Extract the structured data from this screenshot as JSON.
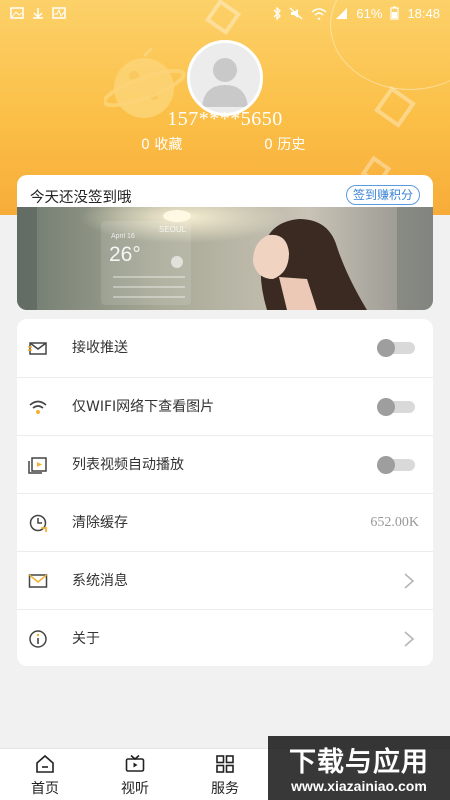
{
  "status_bar": {
    "battery": "61%",
    "time": "18:48"
  },
  "profile": {
    "phone": "157****5650",
    "favorites": "0 收藏",
    "history": "0 历史"
  },
  "signin": {
    "title": "今天还没签到哦",
    "button_label": "签到赚积分"
  },
  "banner": {
    "city": "SEOUL",
    "date": "April 16",
    "temperature": "26°"
  },
  "settings": {
    "items": [
      {
        "label": "接收推送",
        "icon": "envelope-push-icon",
        "type": "toggle",
        "on": false
      },
      {
        "label": "仅WIFI网络下查看图片",
        "icon": "wifi-icon",
        "type": "toggle",
        "on": false
      },
      {
        "label": "列表视频自动播放",
        "icon": "video-play-icon",
        "type": "toggle",
        "on": false
      },
      {
        "label": "清除缓存",
        "icon": "clock-clear-icon",
        "type": "value",
        "value": "652.00K"
      },
      {
        "label": "系统消息",
        "icon": "mail-icon",
        "type": "chevron"
      },
      {
        "label": "关于",
        "icon": "info-icon",
        "type": "chevron"
      }
    ]
  },
  "bottom_nav": {
    "items": [
      {
        "label": "首页",
        "icon": "home-icon"
      },
      {
        "label": "视听",
        "icon": "tv-icon"
      },
      {
        "label": "服务",
        "icon": "grid-icon"
      }
    ]
  },
  "watermark": {
    "main": "下载与应用",
    "sub": "www.xiazainiao.com"
  },
  "colors": {
    "header_top": "#fcd169",
    "header_bottom": "#f7ac39",
    "accent_blue": "#3b84d6",
    "icon_yellow": "#f2b233"
  }
}
